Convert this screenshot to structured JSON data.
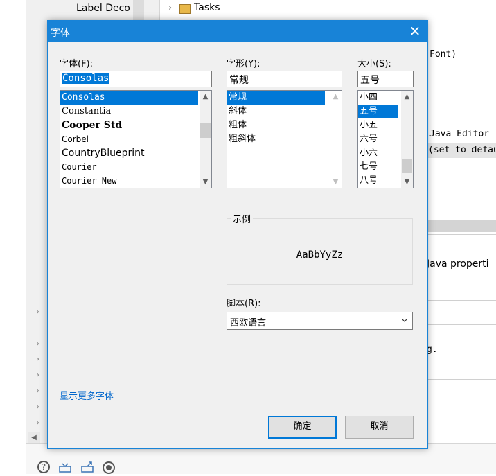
{
  "background": {
    "tree_item": "Label Deco",
    "tasks_label": "Tasks",
    "right_texts": {
      "font_suffix": "Font)",
      "java_editor": "Java Editor",
      "set_default": "(set to defau",
      "java_properties": "Java properti",
      "g_text": "g."
    }
  },
  "dialog": {
    "title": "字体",
    "close_glyph": "✕",
    "font_label": "字体(F):",
    "font_input": "Consolas",
    "font_list": [
      "Consolas",
      "Constantia",
      "Cooper Std",
      "Corbel",
      "CountryBlueprint",
      "Courier",
      "Courier New"
    ],
    "style_label": "字形(Y):",
    "style_input": "常规",
    "style_list": [
      "常规",
      "斜体",
      "粗体",
      "粗斜体"
    ],
    "size_label": "大小(S):",
    "size_input": "五号",
    "size_list": [
      "小四",
      "五号",
      "小五",
      "六号",
      "小六",
      "七号",
      "八号"
    ],
    "sample_label": "示例",
    "sample_text": "AaBbYyZz",
    "script_label": "脚本(R):",
    "script_value": "西欧语言",
    "more_fonts_link": "显示更多字体",
    "ok_button": "确定",
    "cancel_button": "取消"
  },
  "colors": {
    "accent": "#1883d7",
    "selection": "#0078d7",
    "link": "#0066cc"
  }
}
